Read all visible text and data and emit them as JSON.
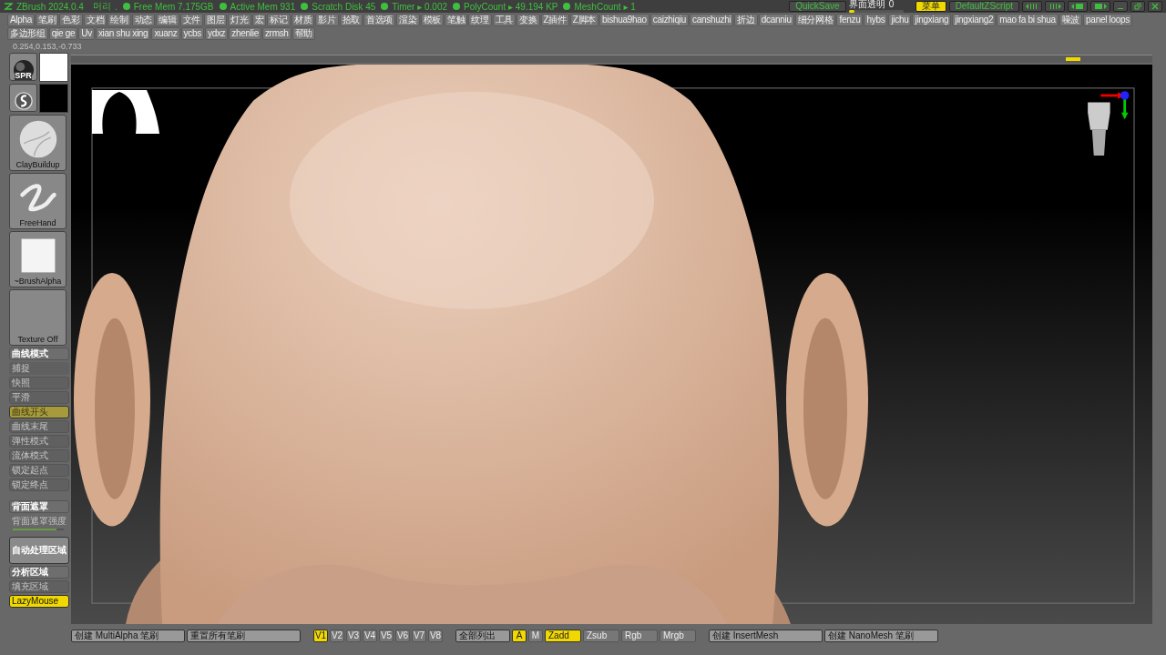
{
  "title_bar": {
    "app": "ZBrush 2024.0.4",
    "project": "머리",
    "separator": ".",
    "stats": [
      "Free Mem 7.175GB",
      "Active Mem 931",
      "Scratch Disk 45",
      "Timer ▸ 0.002",
      "PolyCount ▸ 49.194 KP",
      "MeshCount ▸ 1"
    ],
    "quicksave": "QuickSave",
    "transparency": {
      "label": "界面透明",
      "value": "0",
      "level": 0.1
    },
    "menu_button": {
      "label": "菜单",
      "selected": true
    },
    "script_button": "DefaultZScript"
  },
  "menu_row_1": [
    "Alpha",
    "笔刷",
    "色彩",
    "文档",
    "绘制",
    "动态",
    "编辑",
    "文件",
    "图层",
    "灯光",
    "宏",
    "标记",
    "材质",
    "影片",
    "拾取",
    "首选项",
    "渲染",
    "模板",
    "笔触",
    "纹理",
    "工具",
    "变换",
    "Z插件",
    "Z脚本",
    "bishua9hao",
    "caizhiqiu",
    "canshuzhi",
    "折边",
    "dcanniu",
    "细分网格",
    "fenzu",
    "hybs",
    "jichu",
    "jingxiang",
    "jingxiang2",
    "mao fa bi shua",
    "噪波",
    "panel loops"
  ],
  "menu_row_2": [
    "多边形组",
    "qie ge",
    "Uv",
    "xian shu xing",
    "xuanz",
    "ycbs",
    "ydxz",
    "zhenlie",
    "zrmsh",
    "帮助"
  ],
  "coordinates": "0.254,0.153,-0.733",
  "swatches": [
    {
      "kind": "material",
      "label": "SPR",
      "color": "#ffffff"
    },
    {
      "kind": "stroke",
      "color": "#000000"
    }
  ],
  "brush_tiles": [
    {
      "kind": "sphere",
      "label": "ClayBuildup"
    },
    {
      "kind": "stroke",
      "label": "FreeHand"
    },
    {
      "kind": "alpha",
      "label": "~BrushAlpha"
    },
    {
      "kind": "empty",
      "label": "Texture Off"
    }
  ],
  "stroke_panel": [
    {
      "kind": "toggle",
      "label": "曲线模式",
      "disabled": false,
      "on": false
    },
    {
      "kind": "plain",
      "label": "捕捉",
      "disabled": true,
      "on": false
    },
    {
      "kind": "toggle",
      "label": "快照",
      "disabled": true,
      "on": false
    },
    {
      "kind": "toggle",
      "label": "平滑",
      "disabled": true,
      "on": false
    },
    {
      "kind": "toggle",
      "label": "曲线开头",
      "disabled": true,
      "on": true
    },
    {
      "kind": "toggle",
      "label": "曲线末尾",
      "disabled": true,
      "on": false
    },
    {
      "kind": "toggle",
      "label": "弹性模式",
      "disabled": true,
      "on": false
    },
    {
      "kind": "toggle",
      "label": "流体模式",
      "disabled": true,
      "on": false
    },
    {
      "kind": "toggle",
      "label": "锁定起点",
      "disabled": true,
      "on": false
    },
    {
      "kind": "toggle",
      "label": "锁定终点",
      "disabled": true,
      "on": false
    },
    {
      "kind": "spacer"
    },
    {
      "kind": "toggle",
      "label": "背面遮罩",
      "disabled": false,
      "on": false
    },
    {
      "kind": "slider",
      "label": "背面遮罩强度",
      "disabled": true,
      "level": 0.85
    },
    {
      "kind": "big",
      "label": "自动处理区域",
      "disabled": false,
      "on": false
    },
    {
      "kind": "toggle",
      "label": "分析区域",
      "disabled": false,
      "on": false
    },
    {
      "kind": "toggle",
      "label": "填充区域",
      "disabled": true,
      "on": false
    },
    {
      "kind": "toggle",
      "label": "LazyMouse",
      "disabled": false,
      "on": true
    }
  ],
  "bottom_bar": [
    [
      {
        "kind": "wide",
        "label": "创建 MultiAlpha 笔刷",
        "selected": false
      },
      {
        "kind": "wide",
        "label": "重置所有笔刷",
        "selected": false
      }
    ],
    [
      {
        "kind": "small",
        "label": "V1",
        "selected": true
      },
      {
        "kind": "small",
        "label": "V2",
        "selected": false
      },
      {
        "kind": "small",
        "label": "V3",
        "selected": false
      },
      {
        "kind": "small",
        "label": "V4",
        "selected": false
      },
      {
        "kind": "small",
        "label": "V5",
        "selected": false
      },
      {
        "kind": "small",
        "label": "V6",
        "selected": false
      },
      {
        "kind": "small",
        "label": "V7",
        "selected": false
      },
      {
        "kind": "small",
        "label": "V8",
        "selected": false
      }
    ],
    [
      {
        "kind": "mid",
        "label": "全部列出",
        "selected": false
      },
      {
        "kind": "small",
        "label": "A",
        "selected": true
      },
      {
        "kind": "small",
        "label": "M",
        "selected": false
      },
      {
        "kind": "mode",
        "label": "Zadd",
        "selected": true
      },
      {
        "kind": "mode",
        "label": "Zsub",
        "selected": false
      },
      {
        "kind": "mode",
        "label": "Rgb",
        "selected": false
      },
      {
        "kind": "mode",
        "label": "Mrgb",
        "selected": false
      }
    ],
    [
      {
        "kind": "wide",
        "label": "创建 InsertMesh",
        "selected": false
      },
      {
        "kind": "wide",
        "label": "创建 NanoMesh 笔刷",
        "selected": false
      }
    ]
  ]
}
